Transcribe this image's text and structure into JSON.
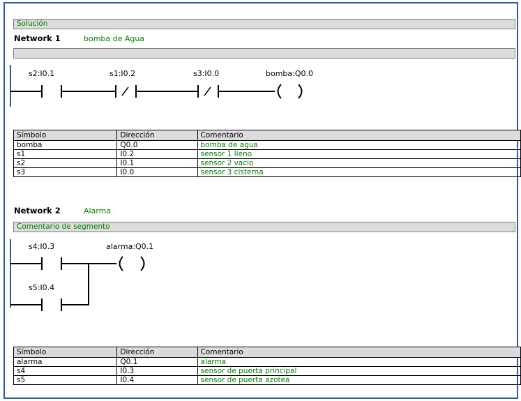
{
  "header": {
    "title": "Solución"
  },
  "networks": [
    {
      "title": "Network 1",
      "name": "bomba de Agua",
      "comment": "",
      "contacts": [
        {
          "label": "s2:I0.1",
          "type": "no"
        },
        {
          "label": "s1:I0.2",
          "type": "nc"
        },
        {
          "label": "s3:I0.0",
          "type": "nc"
        }
      ],
      "coil": {
        "label": "bomba:Q0.0"
      },
      "table": {
        "headers": [
          "Símbolo",
          "Dirección",
          "Comentario"
        ],
        "rows": [
          [
            "bomba",
            "Q0.0",
            "bomba de agua"
          ],
          [
            "s1",
            "I0.2",
            "sensor 1 lleno"
          ],
          [
            "s2",
            "I0.1",
            "sensor 2 vacio"
          ],
          [
            "s3",
            "I0.0",
            "sensor 3 cisterna"
          ]
        ]
      }
    },
    {
      "title": "Network 2",
      "name": "Alarma",
      "comment": "Comentario de segmento",
      "contacts": [
        {
          "label": "s4:I0.3",
          "type": "no"
        },
        {
          "label": "s5:I0.4",
          "type": "no"
        }
      ],
      "coil": {
        "label": "alarma:Q0.1"
      },
      "table": {
        "headers": [
          "Símbolo",
          "Dirección",
          "Comentario"
        ],
        "rows": [
          [
            "alarma",
            "Q0.1",
            "alarma"
          ],
          [
            "s4",
            "I0.3",
            "sensor de puerta principal"
          ],
          [
            "s5",
            "I0.4",
            "sensor de puerta azotea"
          ]
        ]
      }
    }
  ],
  "colors": {
    "frame": "#2a5d9b",
    "comment_text": "#008000",
    "bar_bg": "#dcdcdc"
  }
}
